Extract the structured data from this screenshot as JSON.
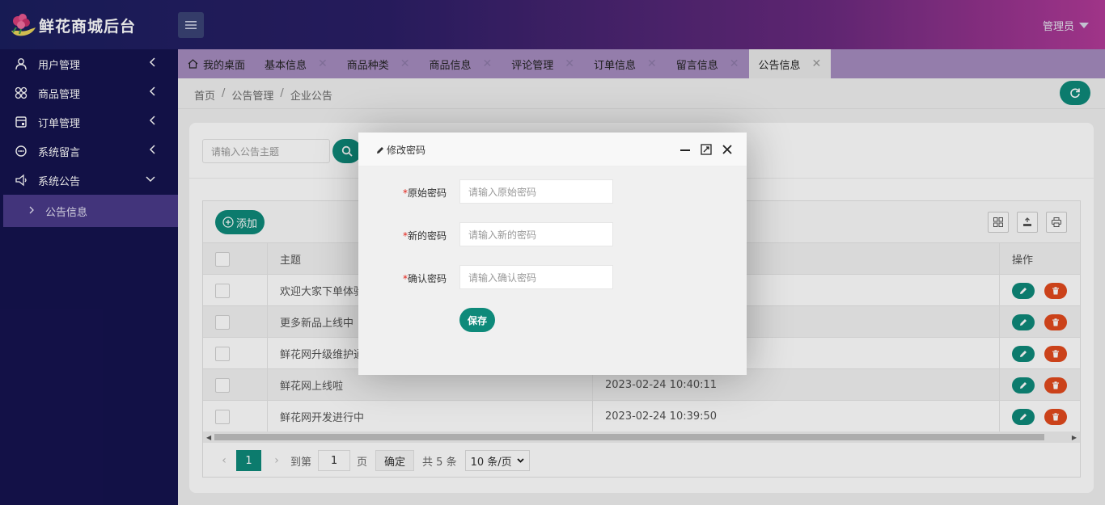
{
  "app": {
    "title": "鲜花商城后台",
    "user": "管理员"
  },
  "sidebar": {
    "items": [
      {
        "label": "用户管理"
      },
      {
        "label": "商品管理"
      },
      {
        "label": "订单管理"
      },
      {
        "label": "系统留言"
      },
      {
        "label": "系统公告"
      }
    ],
    "sub_item": "公告信息"
  },
  "tabs": [
    {
      "label": "我的桌面"
    },
    {
      "label": "基本信息"
    },
    {
      "label": "商品种类"
    },
    {
      "label": "商品信息"
    },
    {
      "label": "评论管理"
    },
    {
      "label": "订单信息"
    },
    {
      "label": "留言信息"
    },
    {
      "label": "公告信息",
      "active": true
    }
  ],
  "breadcrumb": [
    "首页",
    "公告管理",
    "企业公告"
  ],
  "search": {
    "placeholder": "请输入公告主题"
  },
  "toolbar": {
    "add_label": "添加"
  },
  "table": {
    "headers": {
      "title": "主题",
      "actions": "操作"
    },
    "rows": [
      {
        "title": "欢迎大家下单体验",
        "time": ""
      },
      {
        "title": "更多新品上线中",
        "time": ""
      },
      {
        "title": "鲜花网升级维护通",
        "time": ""
      },
      {
        "title": "鲜花网上线啦",
        "time": "2023-02-24 10:40:11"
      },
      {
        "title": "鲜花网开发进行中",
        "time": "2023-02-24 10:39:50"
      }
    ]
  },
  "pager": {
    "current": "1",
    "goto_label": "到第",
    "goto_value": "1",
    "page_unit": "页",
    "confirm": "确定",
    "total": "共 5 条",
    "page_size": "10 条/页"
  },
  "modal": {
    "title": "修改密码",
    "fields": [
      {
        "label": "原始密码",
        "placeholder": "请输入原始密码"
      },
      {
        "label": "新的密码",
        "placeholder": "请输入新的密码"
      },
      {
        "label": "确认密码",
        "placeholder": "请输入确认密码"
      }
    ],
    "required_mark": "*",
    "save_label": "保存"
  },
  "colors": {
    "primary": "#0e8a7a",
    "danger": "#e24a1e",
    "sidebar": "#15134f"
  }
}
